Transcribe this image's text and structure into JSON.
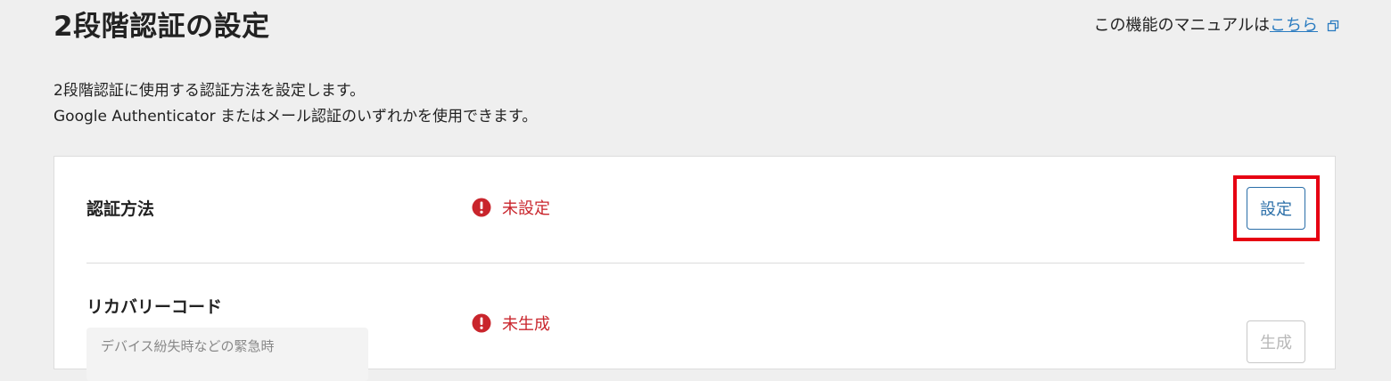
{
  "header": {
    "title": "2段階認証の設定",
    "manual_prefix": "この機能のマニュアルは",
    "manual_link": "こちら"
  },
  "description": {
    "line1": "2段階認証に使用する認証方法を設定します。",
    "line2": "Google Authenticator またはメール認証のいずれかを使用できます。"
  },
  "auth_method": {
    "label": "認証方法",
    "status": "未設定",
    "button": "設定"
  },
  "recovery_code": {
    "label": "リカバリーコード",
    "status": "未生成",
    "hint": "デバイス紛失時などの緊急時",
    "button": "生成"
  },
  "colors": {
    "status_error": "#c9252c",
    "link": "#2a7bc0",
    "highlight": "#e60012",
    "button_primary": "#2a6ea8"
  },
  "icons": {
    "status": "exclamation-circle-icon",
    "manual": "external-link-icon"
  }
}
